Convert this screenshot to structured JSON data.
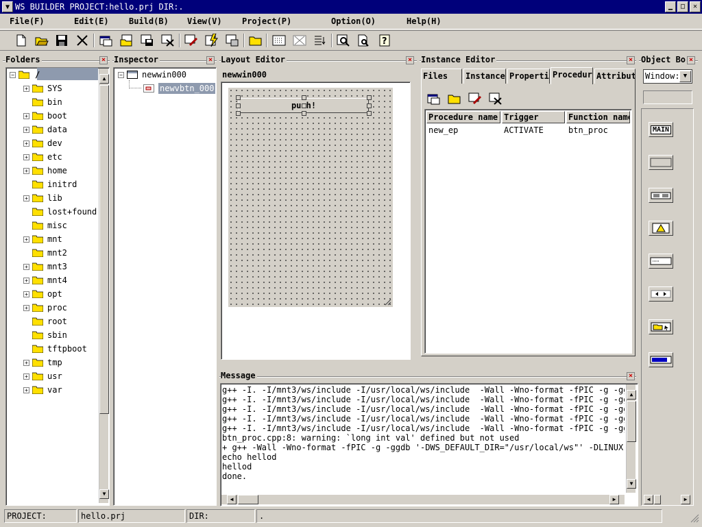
{
  "window": {
    "title": "WS BUILDER PROJECT:hello.prj DIR:."
  },
  "menu": [
    {
      "label": "File(F)"
    },
    {
      "label": "Edit(E)"
    },
    {
      "label": "Build(B)"
    },
    {
      "label": "View(V)"
    },
    {
      "label": "Project(P)"
    },
    {
      "label": "Option(O)"
    },
    {
      "label": "Help(H)"
    }
  ],
  "toolbar": {
    "icons": [
      "new-file-icon",
      "open-folder-icon",
      "save-icon",
      "close-x-icon",
      "new-window-icon",
      "open-window-icon",
      "save-window-icon",
      "delete-window-icon",
      "edit-icon",
      "build-icon",
      "run-icon",
      "open-dir-icon",
      "grid-icon",
      "cut-grid-icon",
      "list-icon",
      "find-icon",
      "preview-icon",
      "help-icon"
    ]
  },
  "folders": {
    "title": "Folders",
    "root": "/",
    "items": [
      "SYS",
      "bin",
      "boot",
      "data",
      "dev",
      "etc",
      "home",
      "initrd",
      "lib",
      "lost+found",
      "misc",
      "mnt",
      "mnt2",
      "mnt3",
      "mnt4",
      "opt",
      "proc",
      "root",
      "sbin",
      "tftpboot",
      "tmp",
      "usr",
      "var"
    ],
    "expandable": [
      true,
      false,
      true,
      true,
      true,
      true,
      true,
      false,
      true,
      false,
      false,
      true,
      false,
      true,
      true,
      true,
      true,
      false,
      false,
      false,
      true,
      true,
      true
    ]
  },
  "inspector": {
    "title": "Inspector",
    "window_item": "newwin000",
    "button_item": "newvbtn_000"
  },
  "layout_editor": {
    "title": "Layout Editor",
    "window_name": "newwin000",
    "button_label": "push!"
  },
  "instance_editor": {
    "title": "Instance Editor",
    "tabs": [
      "Files",
      "Instance",
      "Properti",
      "Procedur",
      "Attribut"
    ],
    "active_tab": "Procedur",
    "columns": [
      "Procedure name",
      "Trigger",
      "Function name"
    ],
    "rows": [
      [
        "new_ep",
        "ACTIVATE",
        "btn_proc"
      ]
    ]
  },
  "object_box": {
    "title": "Object Bo",
    "select_value": "Window:",
    "items": [
      {
        "label": "MAIN",
        "icon": "main-window-icon"
      },
      {
        "label": "",
        "icon": "panel-icon"
      },
      {
        "label": "",
        "icon": "button-pair-icon"
      },
      {
        "label": "",
        "icon": "warning-dialog-icon"
      },
      {
        "label": "",
        "icon": "text-field-icon"
      },
      {
        "label": "",
        "icon": "spin-arrows-icon"
      },
      {
        "label": "",
        "icon": "file-dialog-icon"
      },
      {
        "label": "",
        "icon": "progress-bar-icon"
      }
    ]
  },
  "message": {
    "title": "Message",
    "lines": [
      "g++ -I. -I/mnt3/ws/include -I/usr/local/ws/include  -Wall -Wno-format -fPIC -g -ggdb",
      "g++ -I. -I/mnt3/ws/include -I/usr/local/ws/include  -Wall -Wno-format -fPIC -g -ggdb",
      "g++ -I. -I/mnt3/ws/include -I/usr/local/ws/include  -Wall -Wno-format -fPIC -g -ggdb",
      "g++ -I. -I/mnt3/ws/include -I/usr/local/ws/include  -Wall -Wno-format -fPIC -g -ggdb",
      "g++ -I. -I/mnt3/ws/include -I/usr/local/ws/include  -Wall -Wno-format -fPIC -g -ggdb",
      "btn_proc.cpp:8: warning: `long int val' defined but not used",
      "+ g++ -Wall -Wno-format -fPIC -g -ggdb '-DWS_DEFAULT_DIR=\"/usr/local/ws\"' -DLINUX -c",
      "echo hellod",
      "hellod",
      "done."
    ]
  },
  "status": {
    "project_label": "PROJECT:",
    "project_value": "hello.prj",
    "dir_label": "DIR:",
    "dir_value": "."
  },
  "colors": {
    "titlebar": "#00007a",
    "face": "#d4d0c8",
    "selection": "#8e9aae"
  }
}
